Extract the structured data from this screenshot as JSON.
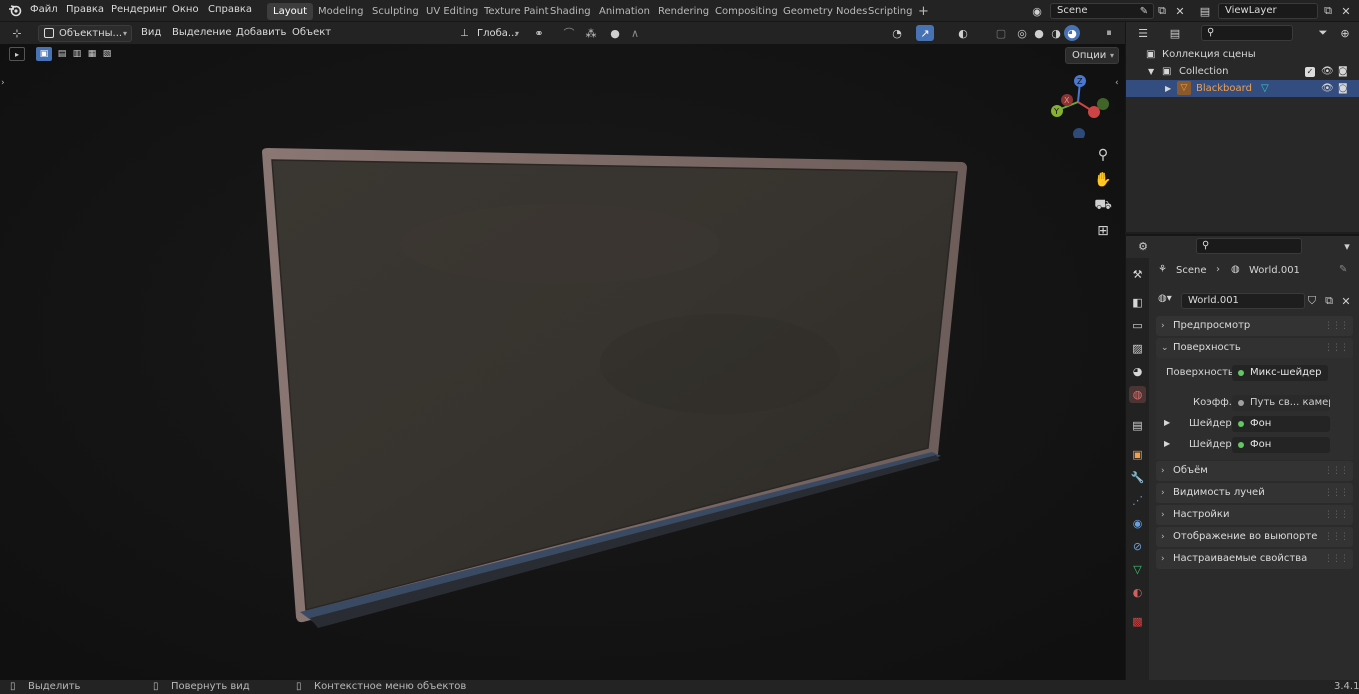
{
  "topbar": {
    "menus": [
      "Файл",
      "Правка",
      "Рендеринг",
      "Окно",
      "Справка"
    ],
    "workspaces": [
      "Layout",
      "Modeling",
      "Sculpting",
      "UV Editing",
      "Texture Paint",
      "Shading",
      "Animation",
      "Rendering",
      "Compositing",
      "Geometry Nodes",
      "Scripting"
    ],
    "active_workspace": "Layout",
    "add_workspace": "+",
    "scene_name": "Scene",
    "view_layer": "ViewLayer"
  },
  "viewport_header": {
    "mode": "Объектны...",
    "menus": [
      "Вид",
      "Выделение",
      "Добавить",
      "Объект"
    ],
    "orientation": "Глоба...",
    "options_label": "Опции"
  },
  "outliner": {
    "scene_collection": "Коллекция сцены",
    "collection": "Collection",
    "object": "Blackboard"
  },
  "properties": {
    "breadcrumb_scene": "Scene",
    "breadcrumb_world": "World.001",
    "world_name": "World.001",
    "panels": {
      "preview": "Предпросмотр",
      "surface": "Поверхность",
      "volume": "Объём",
      "ray_visibility": "Видимость лучей",
      "settings": "Настройки",
      "viewport_display": "Отображение во выюпорте",
      "custom_props": "Настраиваемые свойства"
    },
    "surface": {
      "surface_label": "Поверхность",
      "surface_value": "Микс-шейдер",
      "fac_label": "Коэфф.",
      "fac_value": "Путь св... камеры",
      "shader1_label": "Шейдер",
      "shader1_value": "Фон",
      "shader2_label": "Шейдер",
      "shader2_value": "Фон"
    }
  },
  "statusbar": {
    "select": "Выделить",
    "rotate": "Повернуть вид",
    "context_menu": "Контекстное меню объектов",
    "version": "3.4.1"
  },
  "colors": {
    "accent": "#4772b3",
    "socket": "#63c763",
    "selected_row": "#334d80",
    "object_name": "#f0a04b"
  }
}
